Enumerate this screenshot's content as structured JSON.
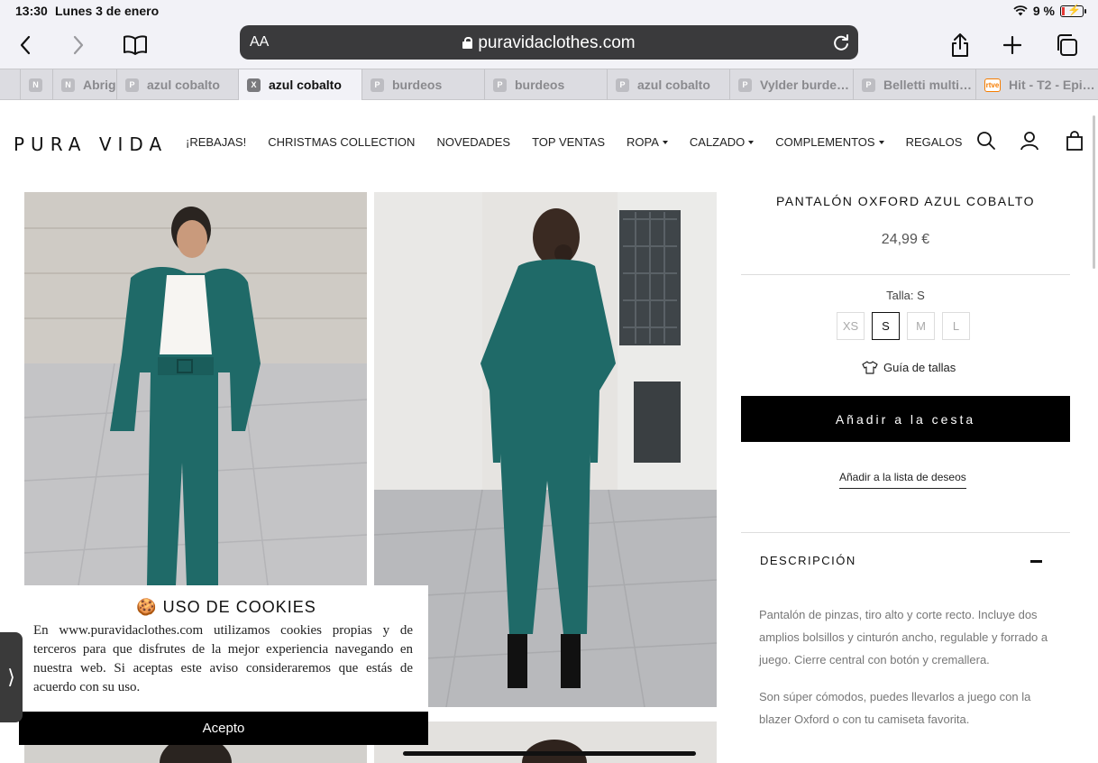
{
  "status_bar": {
    "time": "13:30",
    "date": "Lunes 3 de enero",
    "battery": "9 %"
  },
  "browser": {
    "text_size_button": "AA",
    "url": "puravidaclothes.com",
    "tabs": [
      {
        "label": "",
        "favicon": "N",
        "active": false
      },
      {
        "label": "Abrig",
        "favicon": "N",
        "active": false
      },
      {
        "label": "azul cobalto",
        "favicon": "P",
        "active": false
      },
      {
        "label": "azul cobalto",
        "favicon": "X",
        "active": true
      },
      {
        "label": "burdeos",
        "favicon": "P",
        "active": false
      },
      {
        "label": "burdeos",
        "favicon": "P",
        "active": false
      },
      {
        "label": "azul cobalto",
        "favicon": "P",
        "active": false
      },
      {
        "label": "Vylder burde…",
        "favicon": "P",
        "active": false
      },
      {
        "label": "Belletti multi…",
        "favicon": "P",
        "active": false
      },
      {
        "label": "Hit - T2 - Epi…",
        "favicon": "rtve",
        "active": false
      }
    ]
  },
  "site": {
    "logo": "PURA VIDA",
    "nav": [
      {
        "label": "¡REBAJAS!",
        "dropdown": false
      },
      {
        "label": "CHRISTMAS COLLECTION",
        "dropdown": false
      },
      {
        "label": "NOVEDADES",
        "dropdown": false
      },
      {
        "label": "TOP VENTAS",
        "dropdown": false
      },
      {
        "label": "ROPA",
        "dropdown": true
      },
      {
        "label": "CALZADO",
        "dropdown": true
      },
      {
        "label": "COMPLEMENTOS",
        "dropdown": true
      },
      {
        "label": "REGALOS",
        "dropdown": false
      }
    ]
  },
  "product": {
    "title": "PANTALÓN OXFORD AZUL COBALTO",
    "price": "24,99 €",
    "size_label": "Talla: S",
    "sizes": [
      "XS",
      "S",
      "M",
      "L"
    ],
    "selected_size": "S",
    "size_guide": "Guía de tallas",
    "add_to_cart": "Añadir a la cesta",
    "add_to_wishlist": "Añadir a la lista de deseos",
    "description_title": "DESCRIPCIÓN",
    "description": [
      "Pantalón de pinzas, tiro alto y corte recto. Incluye dos amplios bolsillos y cinturón ancho, regulable y forrado a juego. Cierre central con botón y cremallera.",
      "Son súper cómodos, puedes llevarlos a juego con la blazer Oxford o con tu camiseta favorita."
    ]
  },
  "cookie_banner": {
    "title": "🍪 USO DE COOKIES",
    "text": "En www.puravidaclothes.com utilizamos cookies propias y de terceros para que disfrutes de la mejor experiencia navegando en nuestra web. Si aceptas este aviso consideraremos que estás de acuerdo con su uso.",
    "accept": "Acepto"
  },
  "colors": {
    "suit_green": "#1f6a68",
    "accent_black": "#000000"
  }
}
